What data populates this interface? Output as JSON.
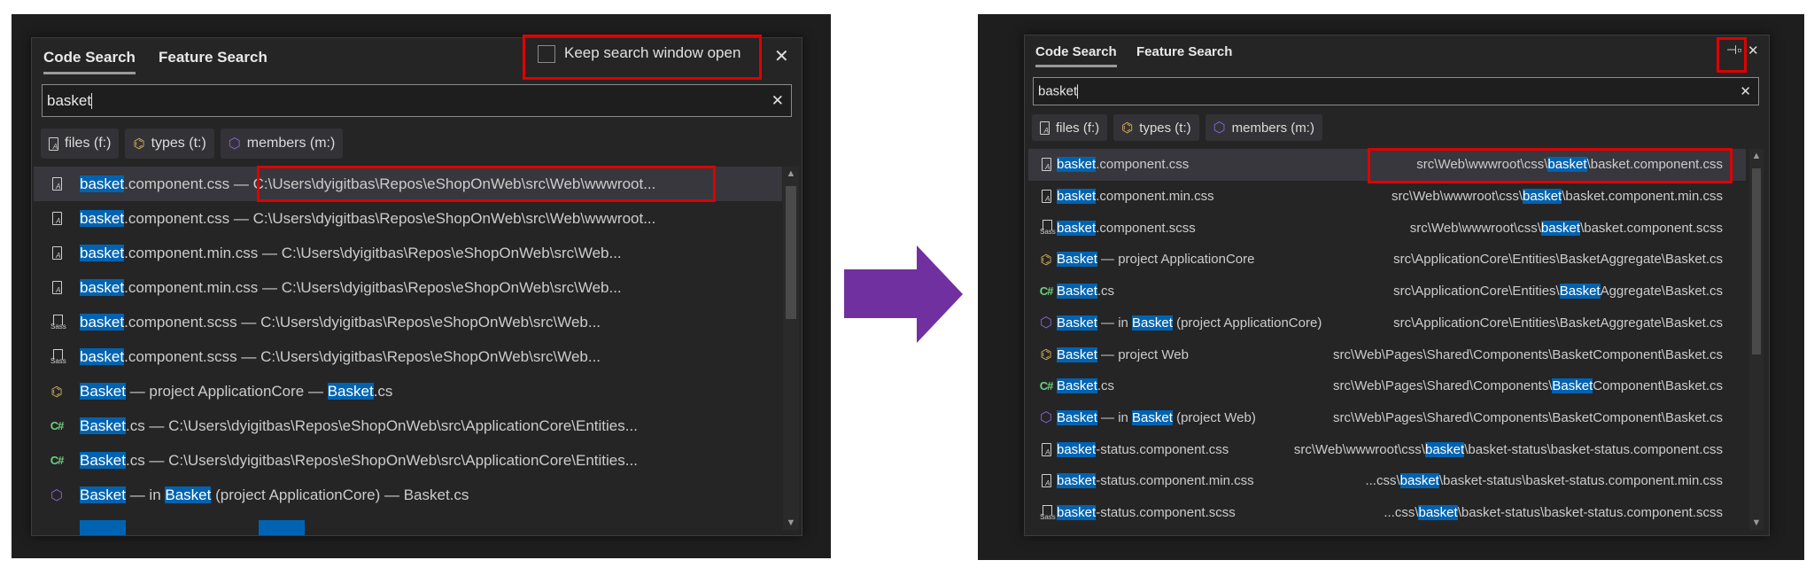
{
  "colors": {
    "highlight": "#0063b1",
    "arrow": "#7030a0",
    "callout": "#e00000",
    "selected_row": "#37373d"
  },
  "before": {
    "tabs": [
      "Code Search",
      "Feature Search"
    ],
    "keep_open_label": "Keep search window open",
    "keep_open_checked": false,
    "close_icon": "close-icon",
    "search_value": "basket",
    "chips": [
      {
        "icon": "file",
        "label": "files (f:)"
      },
      {
        "icon": "type",
        "label": "types (t:)"
      },
      {
        "icon": "member",
        "label": "members (m:)"
      }
    ],
    "rows": [
      {
        "icon": "file",
        "selected": true,
        "segs": [
          {
            "t": "basket",
            "hl": true
          },
          {
            "t": ".component.css — C:\\Users\\dyigitbas\\Repos\\eShopOnWeb\\src\\Web\\wwwroot..."
          }
        ]
      },
      {
        "icon": "file",
        "segs": [
          {
            "t": "basket",
            "hl": true
          },
          {
            "t": ".component.css — C:\\Users\\dyigitbas\\Repos\\eShopOnWeb\\src\\Web\\wwwroot..."
          }
        ]
      },
      {
        "icon": "file",
        "segs": [
          {
            "t": "basket",
            "hl": true
          },
          {
            "t": ".component.min.css — C:\\Users\\dyigitbas\\Repos\\eShopOnWeb\\src\\Web..."
          }
        ]
      },
      {
        "icon": "file",
        "segs": [
          {
            "t": "basket",
            "hl": true
          },
          {
            "t": ".component.min.css — C:\\Users\\dyigitbas\\Repos\\eShopOnWeb\\src\\Web..."
          }
        ]
      },
      {
        "icon": "sass",
        "segs": [
          {
            "t": "basket",
            "hl": true
          },
          {
            "t": ".component.scss — C:\\Users\\dyigitbas\\Repos\\eShopOnWeb\\src\\Web..."
          }
        ]
      },
      {
        "icon": "sass",
        "segs": [
          {
            "t": "basket",
            "hl": true
          },
          {
            "t": ".component.scss — C:\\Users\\dyigitbas\\Repos\\eShopOnWeb\\src\\Web..."
          }
        ]
      },
      {
        "icon": "type",
        "segs": [
          {
            "t": "Basket",
            "hl": true
          },
          {
            "t": " — project ApplicationCore — "
          },
          {
            "t": "Basket",
            "hl": true
          },
          {
            "t": ".cs"
          }
        ]
      },
      {
        "icon": "cs",
        "segs": [
          {
            "t": "Basket",
            "hl": true
          },
          {
            "t": ".cs — C:\\Users\\dyigitbas\\Repos\\eShopOnWeb\\src\\ApplicationCore\\Entities..."
          }
        ]
      },
      {
        "icon": "cs",
        "segs": [
          {
            "t": "Basket",
            "hl": true
          },
          {
            "t": ".cs — C:\\Users\\dyigitbas\\Repos\\eShopOnWeb\\src\\ApplicationCore\\Entities..."
          }
        ]
      },
      {
        "icon": "member",
        "segs": [
          {
            "t": "Basket",
            "hl": true
          },
          {
            "t": " — in "
          },
          {
            "t": "Basket",
            "hl": true
          },
          {
            "t": " (project ApplicationCore) — Basket.cs"
          }
        ]
      }
    ]
  },
  "after": {
    "tabs": [
      "Code Search",
      "Feature Search"
    ],
    "pin_icon": "pin-icon",
    "close_icon": "close-icon",
    "search_value": "basket",
    "chips": [
      {
        "icon": "file",
        "label": "files (f:)"
      },
      {
        "icon": "type",
        "label": "types (t:)"
      },
      {
        "icon": "member",
        "label": "members (m:)"
      }
    ],
    "rows": [
      {
        "icon": "file",
        "selected": true,
        "segs": [
          {
            "t": "basket",
            "hl": true
          },
          {
            "t": ".component.css"
          }
        ],
        "path": [
          {
            "t": "src\\Web\\wwwroot\\css\\"
          },
          {
            "t": "basket",
            "hl": true
          },
          {
            "t": "\\basket.component.css"
          }
        ]
      },
      {
        "icon": "file",
        "segs": [
          {
            "t": "basket",
            "hl": true
          },
          {
            "t": ".component.min.css"
          }
        ],
        "path": [
          {
            "t": "src\\Web\\wwwroot\\css\\"
          },
          {
            "t": "basket",
            "hl": true
          },
          {
            "t": "\\basket.component.min.css"
          }
        ]
      },
      {
        "icon": "sass",
        "segs": [
          {
            "t": "basket",
            "hl": true
          },
          {
            "t": ".component.scss"
          }
        ],
        "path": [
          {
            "t": "src\\Web\\wwwroot\\css\\"
          },
          {
            "t": "basket",
            "hl": true
          },
          {
            "t": "\\basket.component.scss"
          }
        ]
      },
      {
        "icon": "type",
        "segs": [
          {
            "t": "Basket",
            "hl": true
          },
          {
            "t": " — project ApplicationCore"
          }
        ],
        "path": [
          {
            "t": "src\\ApplicationCore\\Entities\\BasketAggregate\\Basket.cs"
          }
        ]
      },
      {
        "icon": "cs",
        "segs": [
          {
            "t": "Basket",
            "hl": true
          },
          {
            "t": ".cs"
          }
        ],
        "path": [
          {
            "t": "src\\ApplicationCore\\Entities\\"
          },
          {
            "t": "Basket",
            "hl": true
          },
          {
            "t": "Aggregate\\Basket.cs"
          }
        ]
      },
      {
        "icon": "member",
        "segs": [
          {
            "t": "Basket",
            "hl": true
          },
          {
            "t": " — in "
          },
          {
            "t": "Basket",
            "hl": true
          },
          {
            "t": " (project ApplicationCore)"
          }
        ],
        "path": [
          {
            "t": "src\\ApplicationCore\\Entities\\BasketAggregate\\Basket.cs"
          }
        ]
      },
      {
        "icon": "type",
        "segs": [
          {
            "t": "Basket",
            "hl": true
          },
          {
            "t": " — project Web"
          }
        ],
        "path": [
          {
            "t": "src\\Web\\Pages\\Shared\\Components\\BasketComponent\\Basket.cs"
          }
        ]
      },
      {
        "icon": "cs",
        "segs": [
          {
            "t": "Basket",
            "hl": true
          },
          {
            "t": ".cs"
          }
        ],
        "path": [
          {
            "t": "src\\Web\\Pages\\Shared\\Components\\"
          },
          {
            "t": "Basket",
            "hl": true
          },
          {
            "t": "Component\\Basket.cs"
          }
        ]
      },
      {
        "icon": "member",
        "segs": [
          {
            "t": "Basket",
            "hl": true
          },
          {
            "t": " — in "
          },
          {
            "t": "Basket",
            "hl": true
          },
          {
            "t": " (project Web)"
          }
        ],
        "path": [
          {
            "t": "src\\Web\\Pages\\Shared\\Components\\BasketComponent\\Basket.cs"
          }
        ]
      },
      {
        "icon": "file",
        "segs": [
          {
            "t": "basket",
            "hl": true
          },
          {
            "t": "-status.component.css"
          }
        ],
        "path": [
          {
            "t": "src\\Web\\wwwroot\\css\\"
          },
          {
            "t": "basket",
            "hl": true
          },
          {
            "t": "\\basket-status\\basket-status.component.css"
          }
        ]
      },
      {
        "icon": "file",
        "segs": [
          {
            "t": "basket",
            "hl": true
          },
          {
            "t": "-status.component.min.css"
          }
        ],
        "path": [
          {
            "t": "...css\\"
          },
          {
            "t": "basket",
            "hl": true
          },
          {
            "t": "\\basket-status\\basket-status.component.min.css"
          }
        ]
      },
      {
        "icon": "sass",
        "segs": [
          {
            "t": "basket",
            "hl": true
          },
          {
            "t": "-status.component.scss"
          }
        ],
        "path": [
          {
            "t": "...css\\"
          },
          {
            "t": "basket",
            "hl": true
          },
          {
            "t": "\\basket-status\\basket-status.component.scss"
          }
        ]
      }
    ]
  }
}
